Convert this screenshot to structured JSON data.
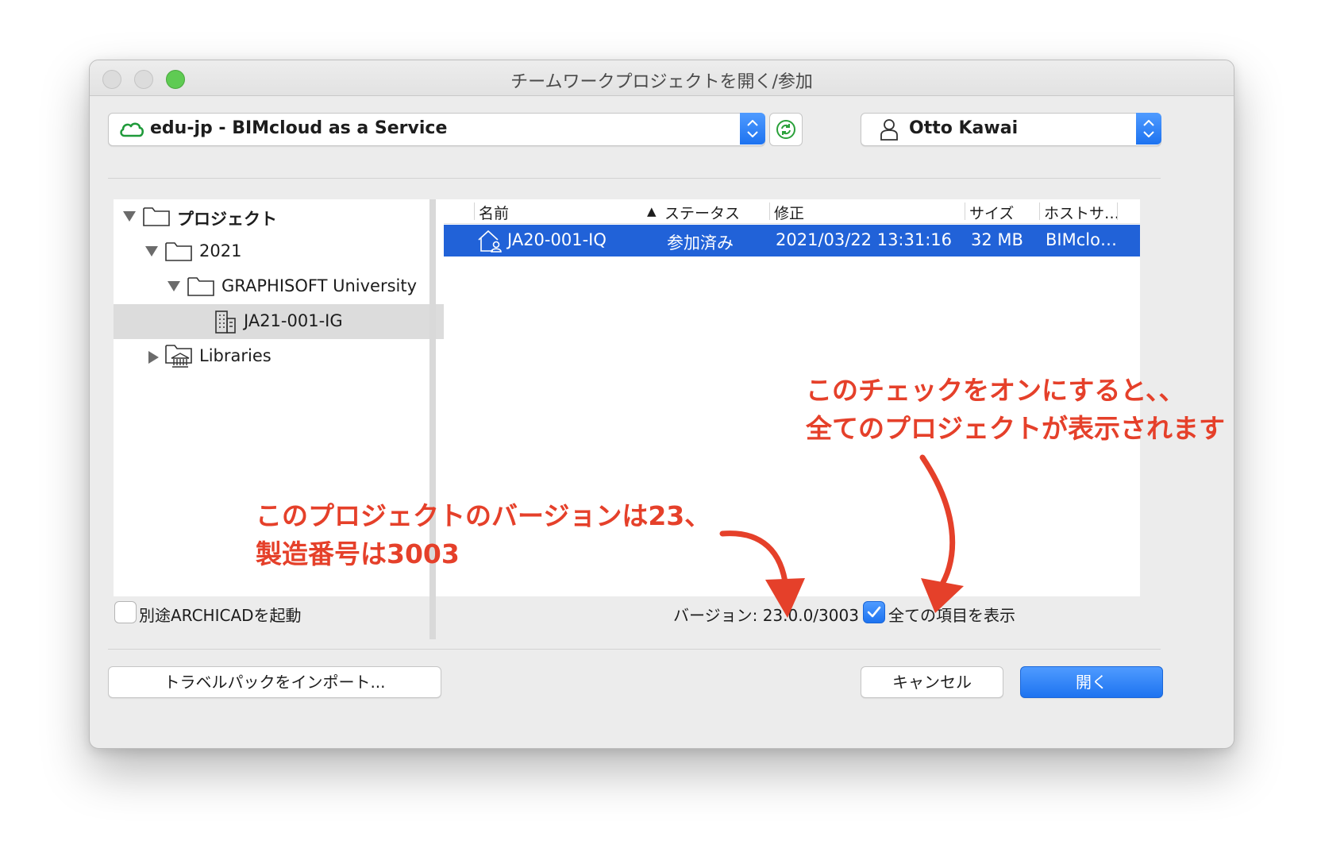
{
  "window": {
    "title": "チームワークプロジェクトを開く/参加"
  },
  "server_select": {
    "value": "edu-jp - BIMcloud as a Service",
    "icon": "cloud-icon",
    "accent": "#1f9a3a"
  },
  "user_select": {
    "value": "Otto Kawai",
    "icon": "user-icon"
  },
  "tree": {
    "items": [
      {
        "label": "プロジェクト",
        "expanded": true,
        "icon": "folder-icon"
      },
      {
        "label": "2021",
        "expanded": true,
        "icon": "folder-icon"
      },
      {
        "label": "GRAPHISOFT University",
        "expanded": true,
        "icon": "folder-icon"
      },
      {
        "label": "JA21-001-IG",
        "selected": true,
        "icon": "building-icon"
      },
      {
        "label": "Libraries",
        "expanded": false,
        "icon": "library-folder-icon"
      }
    ]
  },
  "list": {
    "columns": [
      "名前",
      "ステータス",
      "修正",
      "サイズ",
      "ホストサ…"
    ],
    "sort_indicator": "▲",
    "rows": [
      {
        "name": "JA20-001-IQ",
        "status": "参加済み",
        "modified": "2021/03/22 13:31:16",
        "size": "32 MB",
        "host": "BIMclo…",
        "selected": true
      }
    ]
  },
  "footer": {
    "launch_separately_label": "別途ARCHICADを起動",
    "launch_separately_checked": false,
    "version_text": "バージョン: 23.0.0/3003",
    "show_all_label": "全ての項目を表示",
    "show_all_checked": true
  },
  "buttons": {
    "import": "トラベルパックをインポート...",
    "cancel": "キャンセル",
    "open": "開く"
  },
  "annotations": {
    "checkbox_note_line1": "このチェックをオンにすると、、",
    "checkbox_note_line2": "全てのプロジェクトが表示されます",
    "version_note_line1": "このプロジェクトのバージョンは23、",
    "version_note_line2": "製造番号は3003",
    "color": "#e5402a"
  },
  "colors": {
    "selection": "#2162d8",
    "accent_blue": "#1d73f0"
  }
}
